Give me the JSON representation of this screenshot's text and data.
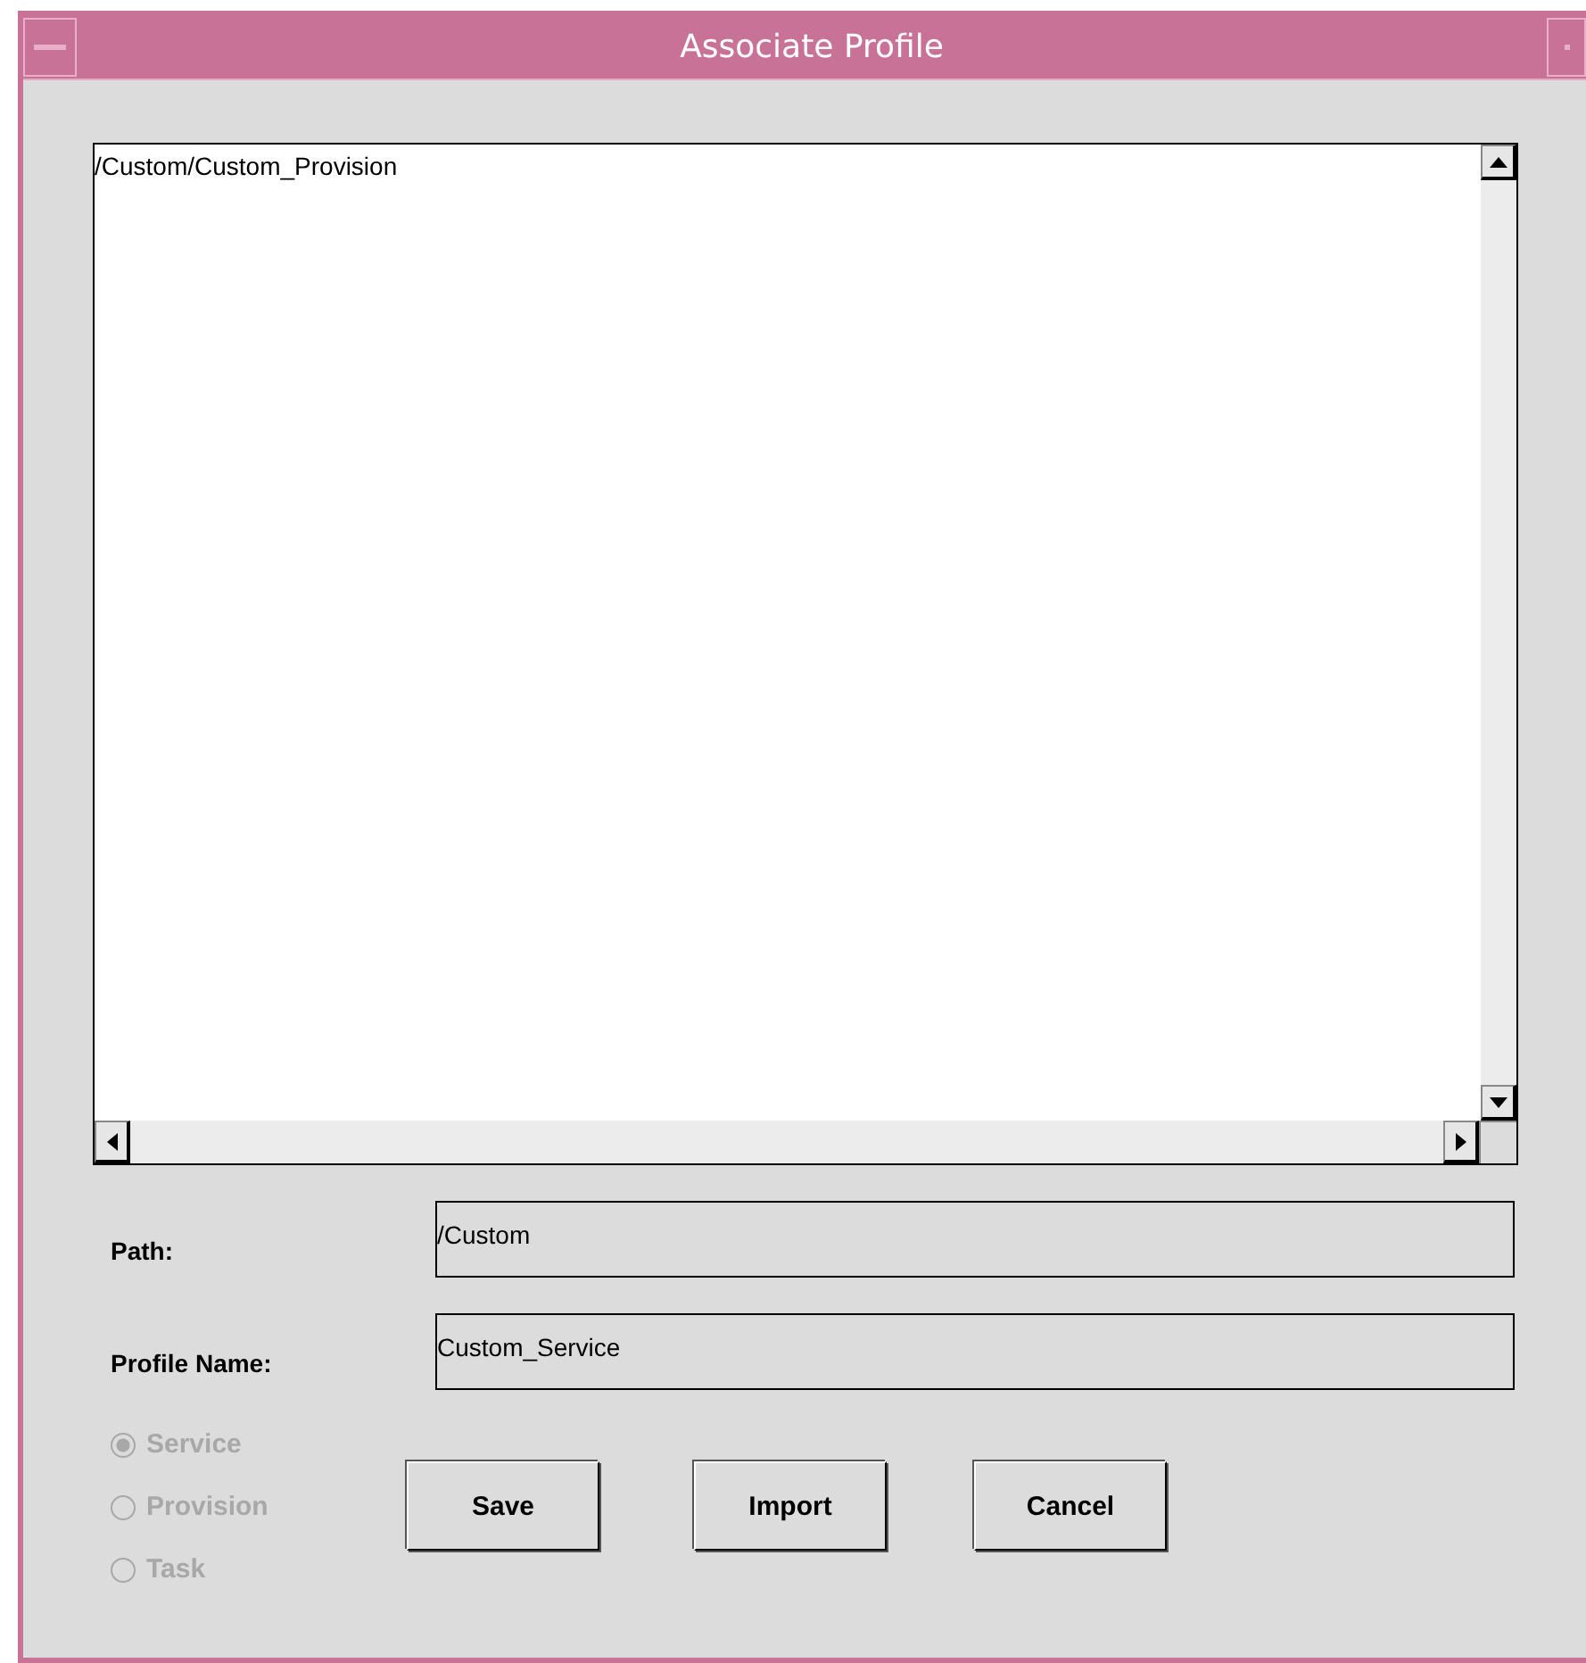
{
  "window": {
    "title": "Associate Profile"
  },
  "list": {
    "items": [
      "/Custom/Custom_Provision"
    ]
  },
  "fields": [
    {
      "label": "Path:",
      "value": "/Custom"
    },
    {
      "label": "Profile Name:",
      "value": "Custom_Service"
    }
  ],
  "profile_type": [
    {
      "label": "Service",
      "selected": true,
      "disabled": true
    },
    {
      "label": "Provision",
      "selected": false,
      "disabled": true
    },
    {
      "label": "Task",
      "selected": false,
      "disabled": true
    }
  ],
  "buttons": [
    "Save",
    "Import",
    "Cancel"
  ]
}
